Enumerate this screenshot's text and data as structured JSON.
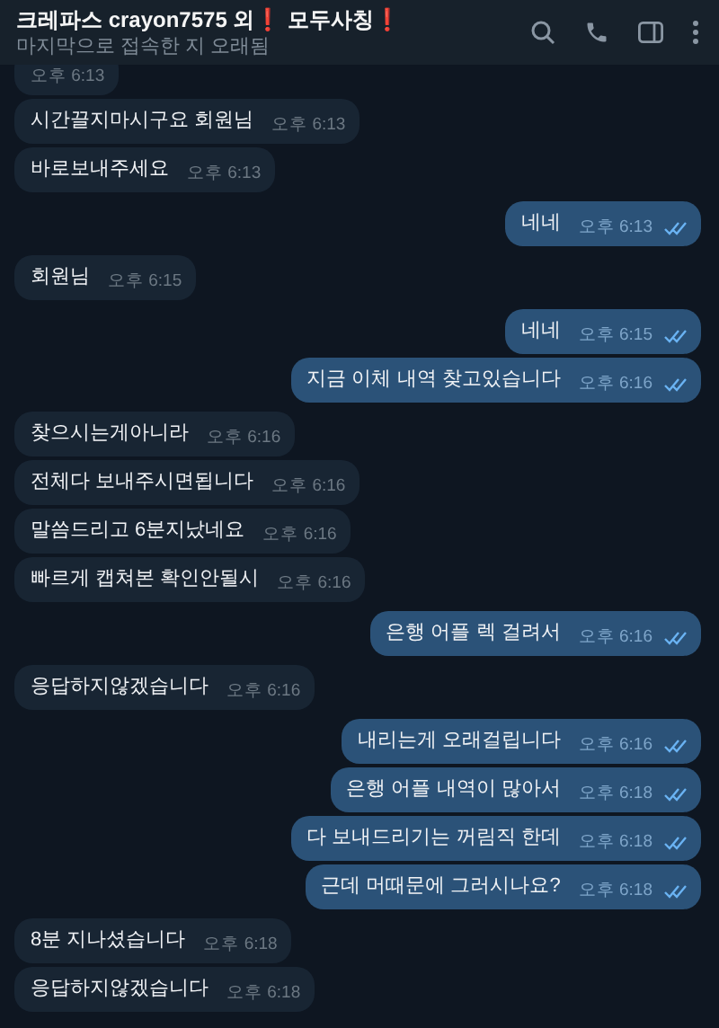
{
  "header": {
    "title_segments": [
      {
        "kind": "text",
        "text": "크레파스 crayon7575 외"
      },
      {
        "kind": "alert",
        "text": "❗"
      },
      {
        "kind": "text",
        "text": " 모두사칭"
      },
      {
        "kind": "alert",
        "text": "❗"
      }
    ],
    "status": "마지막으로 접속한 지 오래됨"
  },
  "messages": [
    {
      "kind": "incoming",
      "time": "오후 6:13"
    },
    {
      "kind": "incoming",
      "text": "시간끌지마시구요 회원님",
      "time": "오후 6:13"
    },
    {
      "kind": "incoming",
      "text": "바로보내주세요",
      "time": "오후 6:13"
    },
    {
      "kind": "outgoing",
      "text": "네네",
      "time": "오후 6:13",
      "read": true
    },
    {
      "kind": "incoming",
      "text": "회원님",
      "time": "오후 6:15"
    },
    {
      "kind": "outgoing",
      "text": "네네",
      "time": "오후 6:15",
      "read": true
    },
    {
      "kind": "outgoing",
      "text": "지금 이체 내역 찾고있습니다",
      "time": "오후 6:16",
      "read": true
    },
    {
      "kind": "incoming",
      "text": "찾으시는게아니라",
      "time": "오후 6:16"
    },
    {
      "kind": "incoming",
      "text": "전체다 보내주시면됩니다",
      "time": "오후 6:16"
    },
    {
      "kind": "incoming",
      "text": "말씀드리고 6분지났네요",
      "time": "오후 6:16"
    },
    {
      "kind": "incoming",
      "text": "빠르게 캡쳐본 확인안될시",
      "time": "오후 6:16"
    },
    {
      "kind": "outgoing",
      "text": "은행 어플 렉 걸려서",
      "time": "오후 6:16",
      "read": true
    },
    {
      "kind": "incoming",
      "text": "응답하지않겠습니다",
      "time": "오후 6:16"
    },
    {
      "kind": "outgoing",
      "text": "내리는게 오래걸립니다",
      "time": "오후 6:16",
      "read": true
    },
    {
      "kind": "outgoing",
      "text": "은행 어플 내역이 많아서",
      "time": "오후 6:18",
      "read": true
    },
    {
      "kind": "outgoing",
      "text": "다 보내드리기는 꺼림직 한데",
      "time": "오후 6:18",
      "read": true
    },
    {
      "kind": "outgoing",
      "text": "근데 머때문에 그러시나요?",
      "time": "오후 6:18",
      "read": true
    },
    {
      "kind": "incoming",
      "text": "8분 지나셨습니다",
      "time": "오후 6:18"
    },
    {
      "kind": "incoming",
      "text": "응답하지않겠습니다",
      "time": "오후 6:18"
    }
  ]
}
